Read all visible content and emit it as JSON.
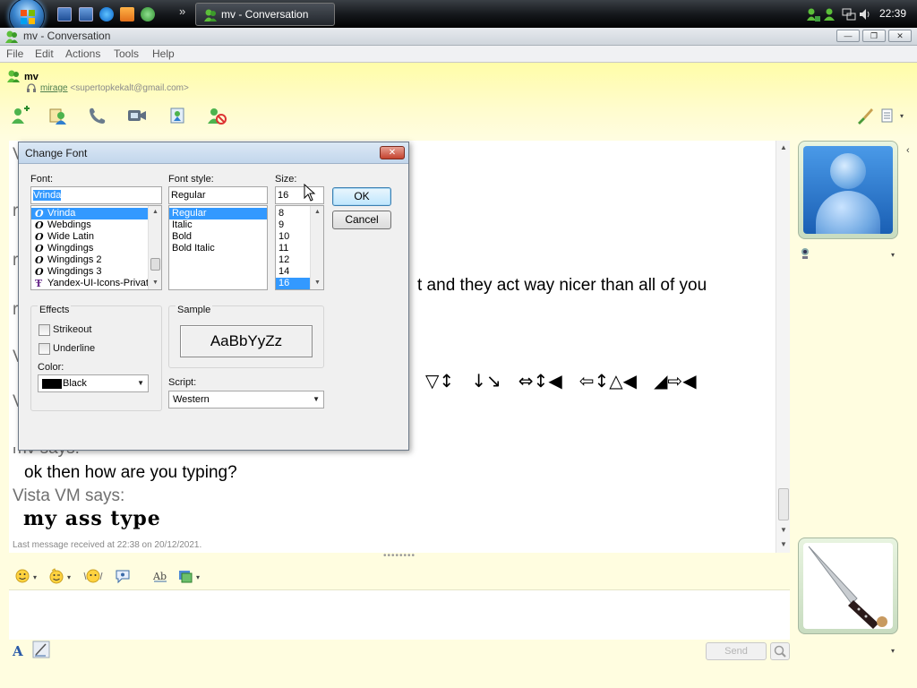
{
  "taskbar": {
    "task_title": "mv - Conversation",
    "clock": "22:39",
    "overflow_chevron": "»"
  },
  "window": {
    "title": "mv - Conversation",
    "controls": {
      "minimize": "—",
      "maximize": "❐",
      "close": "✕"
    }
  },
  "menu": [
    "File",
    "Edit",
    "Actions",
    "Tools",
    "Help"
  ],
  "contact": {
    "name": "mv",
    "nickname": "mirage",
    "email": "<supertopkekalt@gmail.com>"
  },
  "toolbar": {
    "icons": [
      "invite-contact-icon",
      "share-files-icon",
      "call-icon",
      "video-icon",
      "activities-icon",
      "block-icon",
      "paint-brush-icon",
      "menu-options-icon"
    ],
    "right_caret": "▾"
  },
  "conversation": {
    "partial_line": "t and they act way nicer than all of you",
    "symbol_line": "▽↕   ↓↘   ⇔↕◀   ⇦↕△◀   ◢⇨◀",
    "messages": [
      {
        "who": "mv says:",
        "text": "ok then how are you typing?"
      },
      {
        "who": "Vista VM says:",
        "text": "my ass type"
      }
    ],
    "last_message": "Last message received at 22:38 on 20/12/2021.",
    "covered_left_letters": [
      "V",
      "r",
      "r",
      "r",
      "V",
      "V"
    ]
  },
  "format_toolbar": {
    "icons": [
      "emoticon-icon",
      "wink-icon",
      "nudge-icon",
      "voice-clip-icon",
      "font-icon",
      "background-icon"
    ]
  },
  "input": {
    "value": "",
    "send_label": "Send"
  },
  "dialog": {
    "title": "Change Font",
    "close": "✕",
    "font_label": "Font:",
    "font_value": "Vrinda",
    "font_list": [
      "Vrinda",
      "Webdings",
      "Wide Latin",
      "Wingdings",
      "Wingdings 2",
      "Wingdings 3",
      "Yandex-UI-Icons-Privat"
    ],
    "font_selected": "Vrinda",
    "style_label": "Font style:",
    "style_value": "Regular",
    "style_list": [
      "Regular",
      "Italic",
      "Bold",
      "Bold Italic"
    ],
    "style_selected": "Regular",
    "size_label": "Size:",
    "size_value": "16",
    "size_list": [
      "8",
      "9",
      "10",
      "11",
      "12",
      "14",
      "16"
    ],
    "size_selected": "16",
    "ok_label": "OK",
    "cancel_label": "Cancel",
    "effects_label": "Effects",
    "strikeout_label": "Strikeout",
    "strikeout_checked": false,
    "underline_label": "Underline",
    "underline_checked": false,
    "color_label": "Color:",
    "color_value": "Black",
    "color_swatch": "#000000",
    "sample_label": "Sample",
    "sample_text": "AaBbYyZz",
    "script_label": "Script:",
    "script_value": "Western"
  },
  "colors": {
    "header_yellow": "#fffda8",
    "selection_blue": "#3399ff",
    "message_gray": "#707070"
  }
}
